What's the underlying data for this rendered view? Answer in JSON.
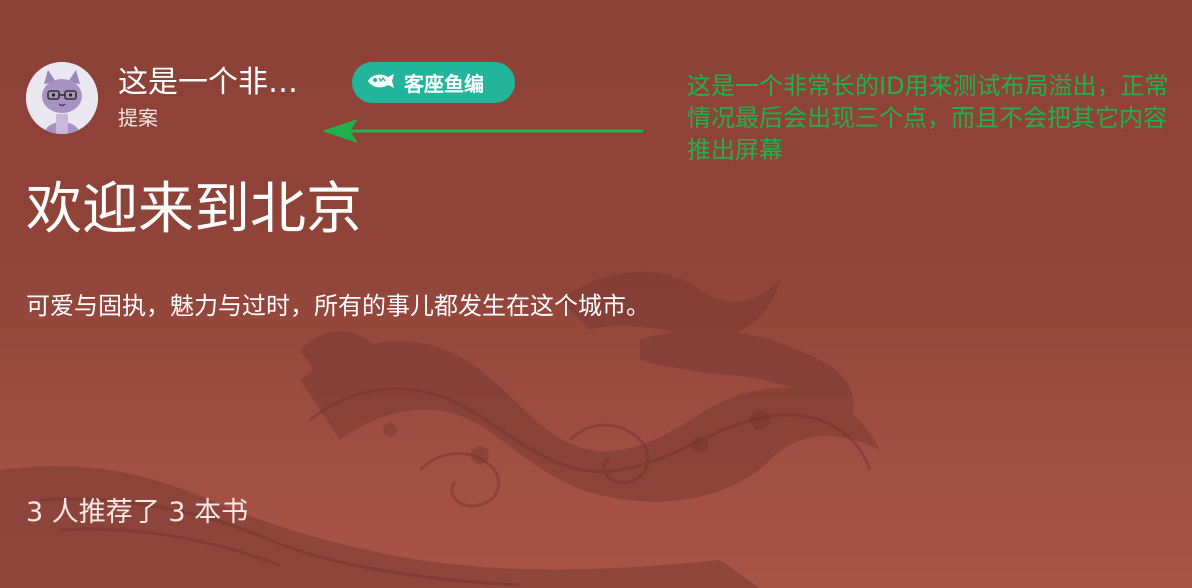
{
  "author": {
    "name": "这是一个非常长的ID用来测试布局溢出",
    "role": "提案"
  },
  "badge": {
    "label": "客座鱼编",
    "icon": "fish-icon",
    "color": "#23b59c"
  },
  "title": "欢迎来到北京",
  "subtitle": "可爱与固执，魅力与过时，所有的事儿都发生在这个城市。",
  "stats": "3 人推荐了 3 本书",
  "annotation": {
    "text": "这是一个非常长的ID用来测试布局溢出，正常情况最后会出现三个点，而且不会把其它内容推出屏幕",
    "color": "#21b14c",
    "arrow_icon": "arrow-left-icon"
  },
  "colors": {
    "background": "#904439",
    "text": "#ffffff"
  }
}
